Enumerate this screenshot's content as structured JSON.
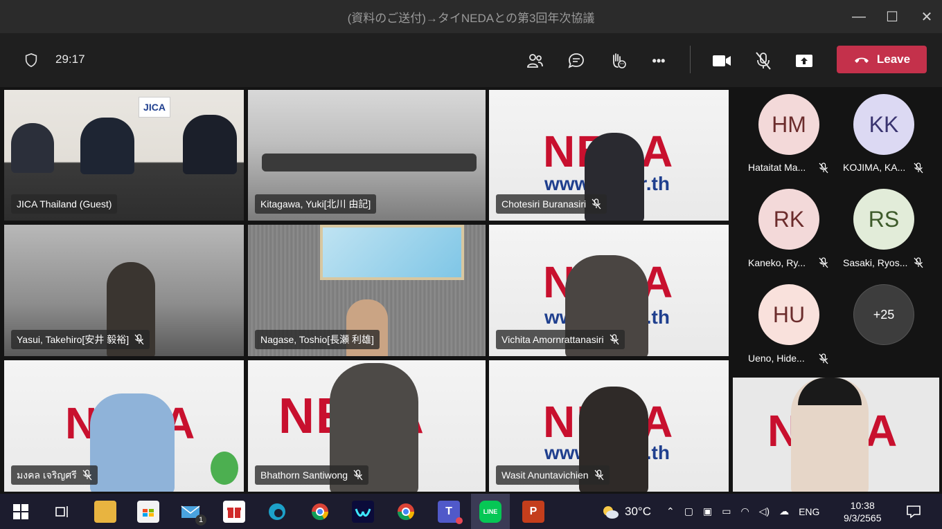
{
  "window": {
    "title": "(資料のご送付)→タイNEDAとの第3回年次協議"
  },
  "toolbar": {
    "timer": "29:17",
    "leave_label": "Leave",
    "more_label": "•••"
  },
  "tiles": [
    {
      "name": "JICA Thailand (Guest)",
      "muted": false,
      "active": true
    },
    {
      "name": "Kitagawa, Yuki[北川 由記]",
      "muted": false,
      "active": false
    },
    {
      "name": "Chotesiri Buranasiri",
      "muted": true,
      "active": false
    },
    {
      "name": "Yasui, Takehiro[安井 毅裕]",
      "muted": true,
      "active": false
    },
    {
      "name": "Nagase, Toshio[長瀬 利雄]",
      "muted": false,
      "active": false
    },
    {
      "name": "Vichita Amornrattanasiri",
      "muted": true,
      "active": false
    },
    {
      "name": "มงคล เจริญศรี",
      "muted": true,
      "active": false
    },
    {
      "name": "Bhathorn Santiwong",
      "muted": true,
      "active": false
    },
    {
      "name": "Wasit Anuntavichien",
      "muted": true,
      "active": false
    }
  ],
  "backgrounds": {
    "neda_word": "NEDA",
    "neda_url": "www.ne  .or.th",
    "jica_logo": "JICA"
  },
  "roster": [
    {
      "initials": "HM",
      "name": "Hataitat Ma...",
      "color": "#f3d9d9",
      "text": "#6b2c2c"
    },
    {
      "initials": "KK",
      "name": "KOJIMA, KA...",
      "color": "#dcd9f3",
      "text": "#3a3470"
    },
    {
      "initials": "RK",
      "name": "Kaneko, Ry...",
      "color": "#f3d9d9",
      "text": "#6b2c2c"
    },
    {
      "initials": "RS",
      "name": "Sasaki, Ryos...",
      "color": "#e2ecd9",
      "text": "#3d5a2a"
    },
    {
      "initials": "HU",
      "name": "Ueno, Hide...",
      "color": "#f9e1dc",
      "text": "#6b2c2c"
    },
    {
      "initials": "+25",
      "name": "",
      "color": "#3d3d3d",
      "text": "#ffffff"
    }
  ],
  "taskbar": {
    "weather": "30°C",
    "lang": "ENG",
    "time": "10:38",
    "date": "9/3/2565",
    "mail_badge": "1",
    "line_label": "LINE"
  },
  "colors": {
    "accent": "#7f85f5",
    "leave": "#c4314b",
    "neda_red": "#c8102e",
    "neda_blue": "#1f3f8e"
  }
}
